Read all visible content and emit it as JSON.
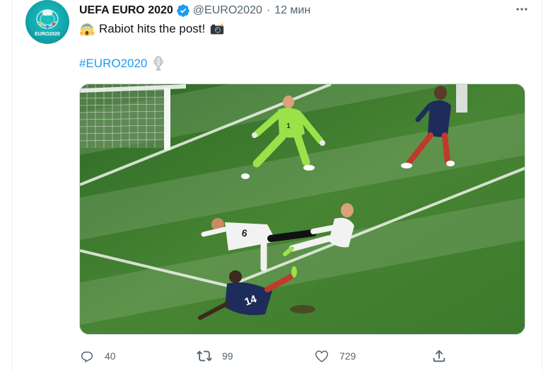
{
  "tweet": {
    "display_name": "UEFA EURO 2020",
    "handle": "@EURO2020",
    "separator": "·",
    "time": "12 мин",
    "text": "Rabiot hits the post!",
    "hashtag": "#EURO2020",
    "avatar_label": "EURO2020",
    "player_number_left": "14",
    "player_number_right": "6"
  },
  "icons": {
    "verified": "verified-badge-icon",
    "more": "more-icon",
    "emoji_1": "screaming-face-emoji",
    "emoji_2": "camera-flash-emoji",
    "trophy": "trophy-emoji"
  },
  "actions": {
    "reply_count": "40",
    "retweet_count": "99",
    "like_count": "729"
  },
  "colors": {
    "accent": "#1d9bf0",
    "secondary_text": "#536471",
    "verified": "#1d9bf0",
    "pitch": "#3f7a32"
  }
}
